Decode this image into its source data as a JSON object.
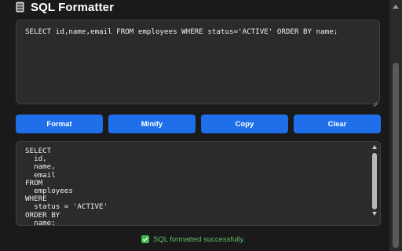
{
  "header": {
    "title": "SQL Formatter",
    "icon": "database-icon"
  },
  "input": {
    "value": "SELECT id,name,email FROM employees WHERE status='ACTIVE' ORDER BY name;"
  },
  "buttons": {
    "format": "Format",
    "minify": "Minify",
    "copy": "Copy",
    "clear": "Clear"
  },
  "output": {
    "value": "SELECT\n  id,\n  name,\n  email\nFROM\n  employees\nWHERE\n  status = 'ACTIVE'\nORDER BY\n  name;"
  },
  "status": {
    "message": "SQL formatted successfully.",
    "icon": "check-icon"
  },
  "colors": {
    "accent": "#1f6feb",
    "success": "#3fb950",
    "background": "#1a1a1a",
    "panel": "#2b2b2b"
  }
}
